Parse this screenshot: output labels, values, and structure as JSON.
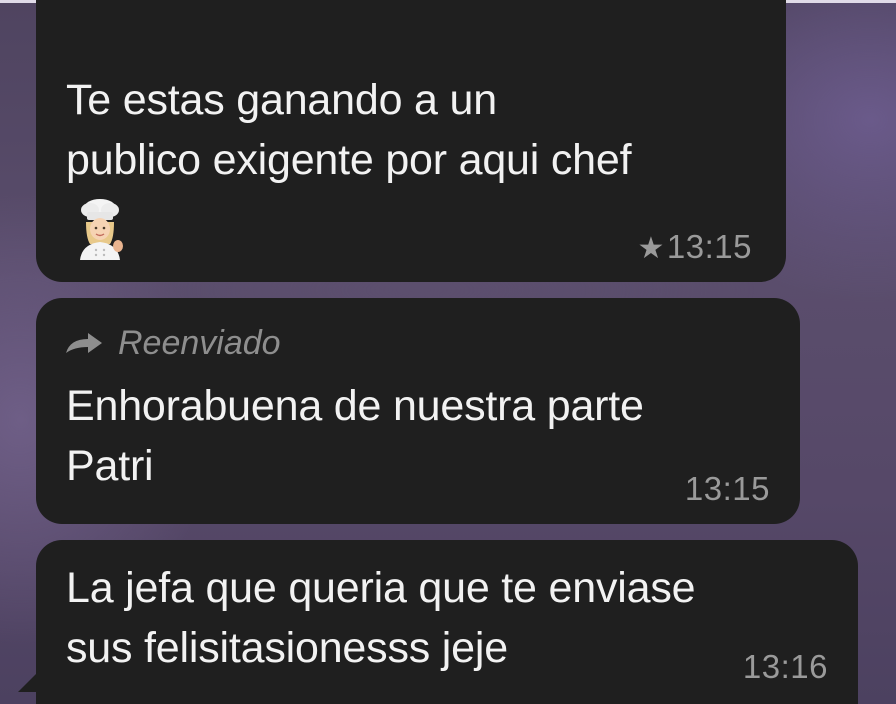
{
  "messages": [
    {
      "text_line1": "Te estas ganando a un",
      "text_line2": "publico exigente por aqui chef",
      "emoji": "chef-emoji",
      "starred": true,
      "time": "13:15"
    },
    {
      "forwarded_label": "Reenviado",
      "text_line1": "Enhorabuena de nuestra parte",
      "text_line2": "Patri",
      "time": "13:15"
    },
    {
      "text_line1": "La jefa que queria que te enviase",
      "text_line2": "sus felisitasionesss jeje",
      "time": "13:16"
    }
  ],
  "colors": {
    "bubble_bg": "#1f1f1f",
    "text": "#f2f2f2",
    "meta": "#9a9a9a",
    "wallpaper": "#544866"
  }
}
